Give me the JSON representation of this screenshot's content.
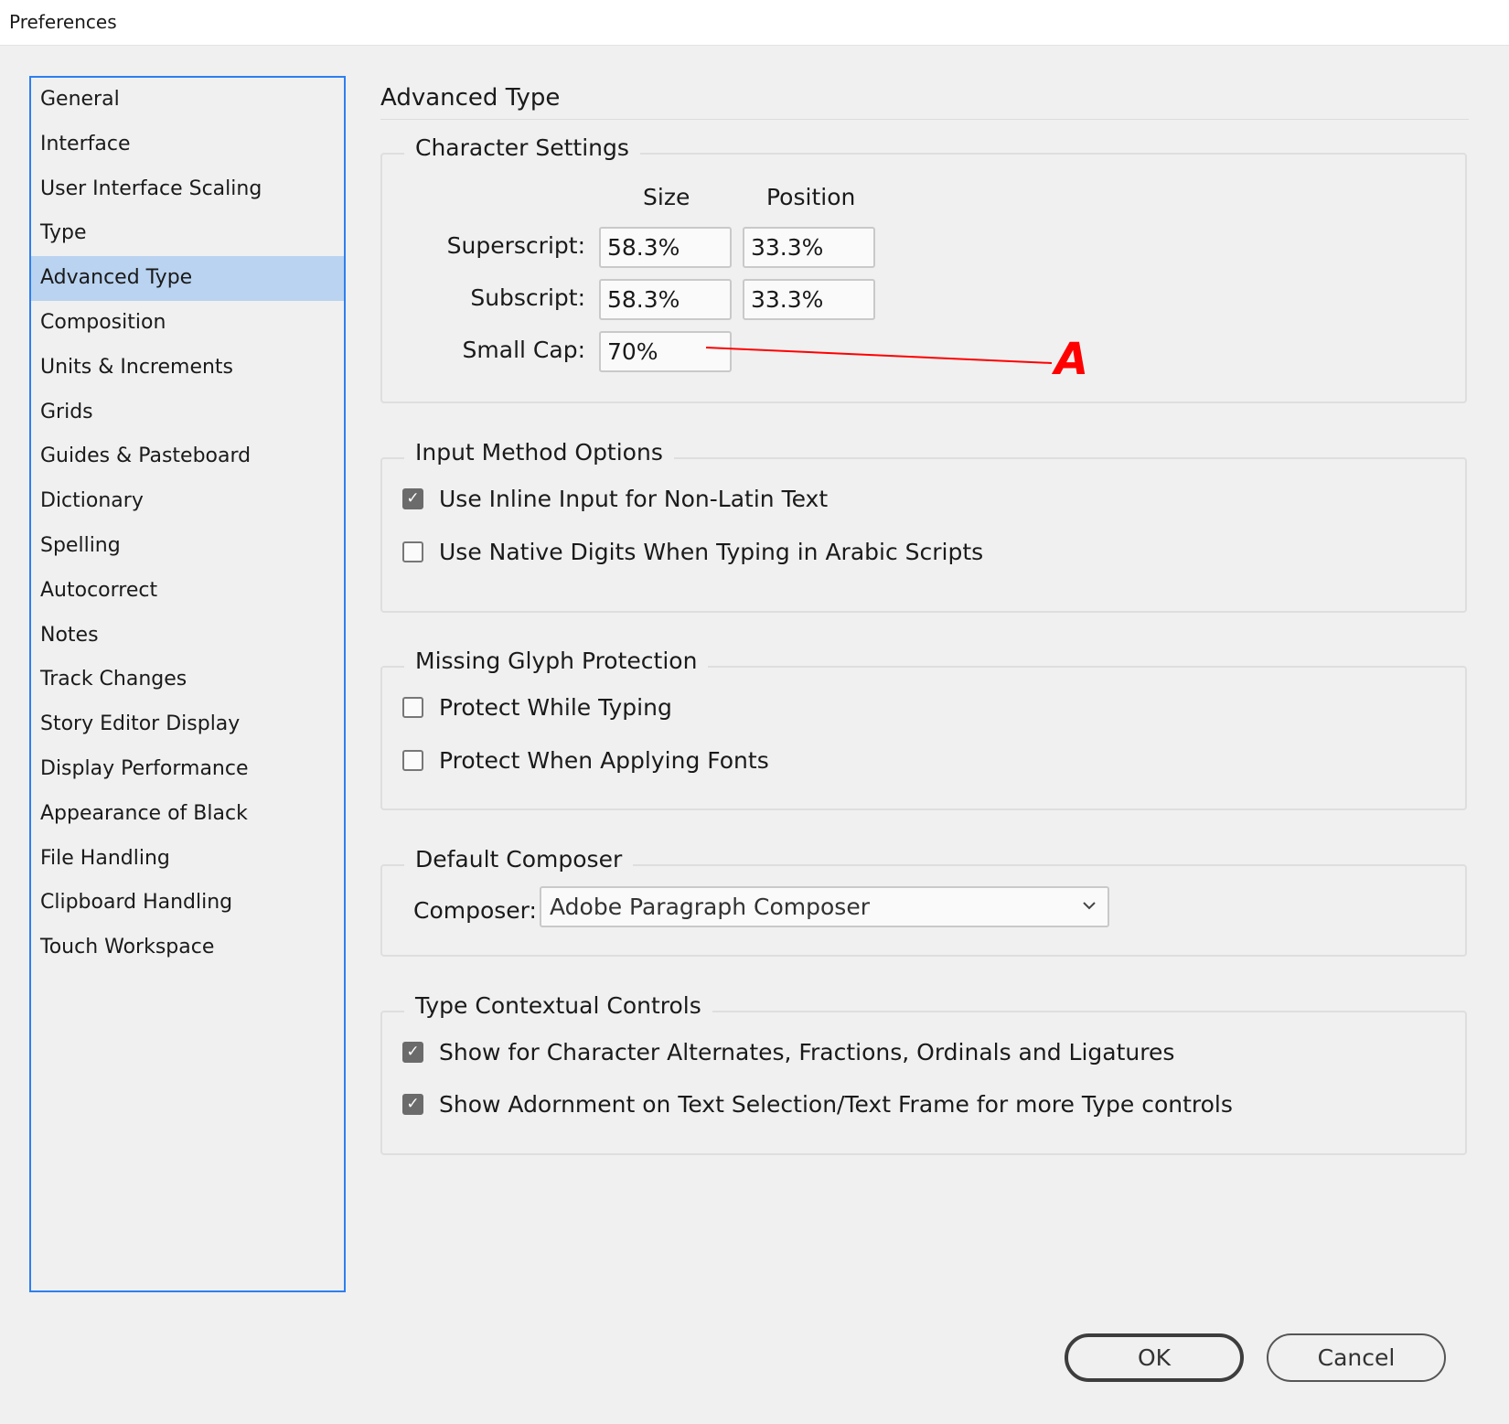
{
  "window": {
    "title": "Preferences"
  },
  "sidebar": {
    "items": [
      {
        "label": "General"
      },
      {
        "label": "Interface"
      },
      {
        "label": "User Interface Scaling"
      },
      {
        "label": "Type"
      },
      {
        "label": "Advanced Type",
        "selected": true
      },
      {
        "label": "Composition"
      },
      {
        "label": "Units & Increments"
      },
      {
        "label": "Grids"
      },
      {
        "label": "Guides & Pasteboard"
      },
      {
        "label": "Dictionary"
      },
      {
        "label": "Spelling"
      },
      {
        "label": "Autocorrect"
      },
      {
        "label": "Notes"
      },
      {
        "label": "Track Changes"
      },
      {
        "label": "Story Editor Display"
      },
      {
        "label": "Display Performance"
      },
      {
        "label": "Appearance of Black"
      },
      {
        "label": "File Handling"
      },
      {
        "label": "Clipboard Handling"
      },
      {
        "label": "Touch Workspace"
      }
    ],
    "accent_color": "#2d7ff0",
    "selected_color": "#b9d3f0"
  },
  "panel": {
    "title": "Advanced Type",
    "character_settings": {
      "legend": "Character Settings",
      "col_size": "Size",
      "col_position": "Position",
      "superscript": {
        "label": "Superscript:",
        "size": "58.3%",
        "position": "33.3%"
      },
      "subscript": {
        "label": "Subscript:",
        "size": "58.3%",
        "position": "33.3%"
      },
      "small_cap": {
        "label": "Small Cap:",
        "size": "70%"
      }
    },
    "input_method": {
      "legend": "Input Method Options",
      "options": [
        {
          "label": "Use Inline Input for Non-Latin Text",
          "checked": true
        },
        {
          "label": "Use Native Digits When Typing in Arabic Scripts",
          "checked": false
        }
      ]
    },
    "missing_glyph": {
      "legend": "Missing Glyph Protection",
      "options": [
        {
          "label": "Protect While Typing",
          "checked": false
        },
        {
          "label": "Protect When Applying Fonts",
          "checked": false
        }
      ]
    },
    "default_composer": {
      "legend": "Default Composer",
      "label": "Composer:",
      "value": "Adobe Paragraph Composer"
    },
    "type_contextual": {
      "legend": "Type Contextual Controls",
      "options": [
        {
          "label": "Show for Character Alternates, Fractions, Ordinals and Ligatures",
          "checked": true
        },
        {
          "label": "Show Adornment on Text Selection/Text Frame for more Type controls",
          "checked": true
        }
      ]
    }
  },
  "annotation": {
    "letter": "A",
    "color": "#ff0000"
  },
  "buttons": {
    "ok": "OK",
    "cancel": "Cancel"
  }
}
